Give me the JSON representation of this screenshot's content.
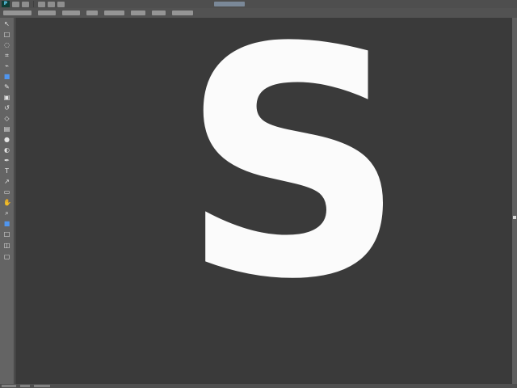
{
  "canvas": {
    "glyph": "S"
  },
  "ui": {
    "theme": {
      "workspace": "#5d5d5d",
      "canvas": "#3a3a3a",
      "glyph": "#fbfbfb",
      "active_tool": "#4e9cff",
      "accent_chip": "#7a8898"
    },
    "toolbar_icons": [
      "app-icon",
      "document-icon",
      "layers-icon",
      "adjustments-icon",
      "settings-icon",
      "history-icon"
    ],
    "tool_icons": [
      "move-icon",
      "marquee-icon",
      "lasso-icon",
      "crop-icon",
      "eyedropper-icon",
      "healing-icon",
      "brush-icon",
      "stamp-icon",
      "history-brush-icon",
      "eraser-icon",
      "gradient-icon",
      "blur-icon",
      "dodge-icon",
      "pen-icon",
      "type-icon",
      "path-selection-icon",
      "shape-icon",
      "hand-icon",
      "zoom-icon",
      "foreground-color-icon",
      "background-color-icon",
      "mask-icon",
      "screen-mode-icon"
    ]
  }
}
